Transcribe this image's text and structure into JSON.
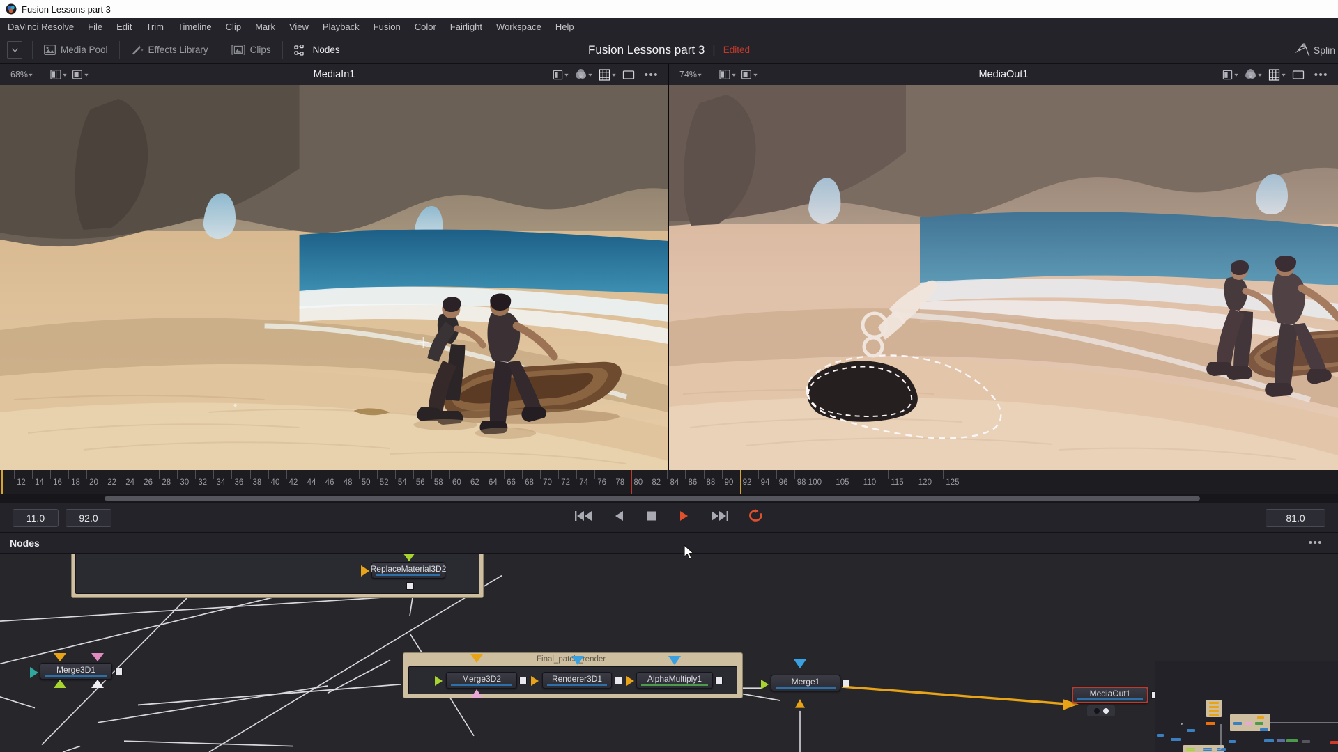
{
  "window": {
    "title": "Fusion Lessons part 3",
    "logo_icon": "davinci-resolve-logo"
  },
  "menubar": {
    "items": [
      {
        "label": "DaVinci Resolve"
      },
      {
        "label": "File"
      },
      {
        "label": "Edit"
      },
      {
        "label": "Trim"
      },
      {
        "label": "Timeline"
      },
      {
        "label": "Clip"
      },
      {
        "label": "Mark"
      },
      {
        "label": "View"
      },
      {
        "label": "Playback"
      },
      {
        "label": "Fusion"
      },
      {
        "label": "Color"
      },
      {
        "label": "Fairlight"
      },
      {
        "label": "Workspace"
      },
      {
        "label": "Help"
      }
    ]
  },
  "toolbar": {
    "collapse_icon": "chevron-down-icon",
    "buttons": [
      {
        "label": "Media Pool",
        "icon": "media-pool-icon",
        "active": false
      },
      {
        "label": "Effects Library",
        "icon": "effects-library-icon",
        "active": false
      },
      {
        "label": "Clips",
        "icon": "clips-icon",
        "active": false
      },
      {
        "label": "Nodes",
        "icon": "nodes-icon",
        "active": true
      }
    ],
    "project_title": "Fusion Lessons part 3",
    "divider": "|",
    "status": "Edited",
    "spline_label": "Splin",
    "spline_icon": "spline-editor-icon"
  },
  "viewers": [
    {
      "id": "left",
      "zoom": "68%",
      "name": "MediaIn1",
      "left_controls": [
        "split-view-icon",
        "image-view-icon"
      ],
      "right_controls": [
        "lut-icon",
        "color-icon",
        "grid-icon",
        "frame-icon"
      ],
      "overflow": "•••"
    },
    {
      "id": "right",
      "zoom": "74%",
      "name": "MediaOut1",
      "left_controls": [
        "split-view-icon",
        "image-view-icon"
      ],
      "right_controls": [
        "lut-icon",
        "color-icon",
        "grid-icon",
        "frame-icon"
      ],
      "overflow": "•••"
    }
  ],
  "timeline": {
    "ticks_minor": [
      12,
      14,
      16,
      18,
      20,
      22,
      24,
      26,
      28,
      30,
      32,
      34,
      36,
      38,
      40,
      42,
      44,
      46,
      48,
      50,
      52,
      54,
      56,
      58,
      60,
      62,
      64,
      66,
      68,
      70,
      72,
      74,
      76,
      78,
      80,
      82,
      84,
      86,
      88,
      90,
      92,
      94,
      96,
      98
    ],
    "ticks_major": [
      100,
      105,
      110,
      115,
      120,
      125
    ],
    "render_range_start": 80,
    "playhead": 92,
    "range_in": "11.0",
    "range_out": "92.0",
    "current_frame": "81.0"
  },
  "transport": {
    "buttons": [
      {
        "name": "skip-to-start",
        "icon": "skip-start-icon",
        "active": false
      },
      {
        "name": "play-reverse",
        "icon": "play-reverse-icon",
        "active": false
      },
      {
        "name": "stop",
        "icon": "stop-icon",
        "active": false
      },
      {
        "name": "play",
        "icon": "play-icon",
        "active": true
      },
      {
        "name": "skip-to-end",
        "icon": "skip-end-icon",
        "active": false
      },
      {
        "name": "loop",
        "icon": "loop-icon",
        "active": true
      }
    ]
  },
  "nodes_panel": {
    "title": "Nodes",
    "overflow": "•••",
    "group": {
      "label": "Final_patch_render",
      "members": [
        "Merge3D2",
        "Renderer3D1",
        "AlphaMultiply1"
      ]
    },
    "nodes": [
      {
        "name": "ReplaceMaterial3D2",
        "selected": false
      },
      {
        "name": "Merge3D1",
        "selected": false
      },
      {
        "name": "Merge3D2",
        "selected": false
      },
      {
        "name": "Renderer3D1",
        "selected": false
      },
      {
        "name": "AlphaMultiply1",
        "selected": false
      },
      {
        "name": "Merge1",
        "selected": false
      },
      {
        "name": "MediaOut1",
        "selected": true
      }
    ]
  },
  "colors": {
    "accent_red": "#c0392b",
    "accent_orange": "#e8a317",
    "node_bar_blue": "#2f6fa8",
    "group_tan": "#cdbfa0",
    "panel_bg": "#232329",
    "graph_bg": "#26262b"
  }
}
